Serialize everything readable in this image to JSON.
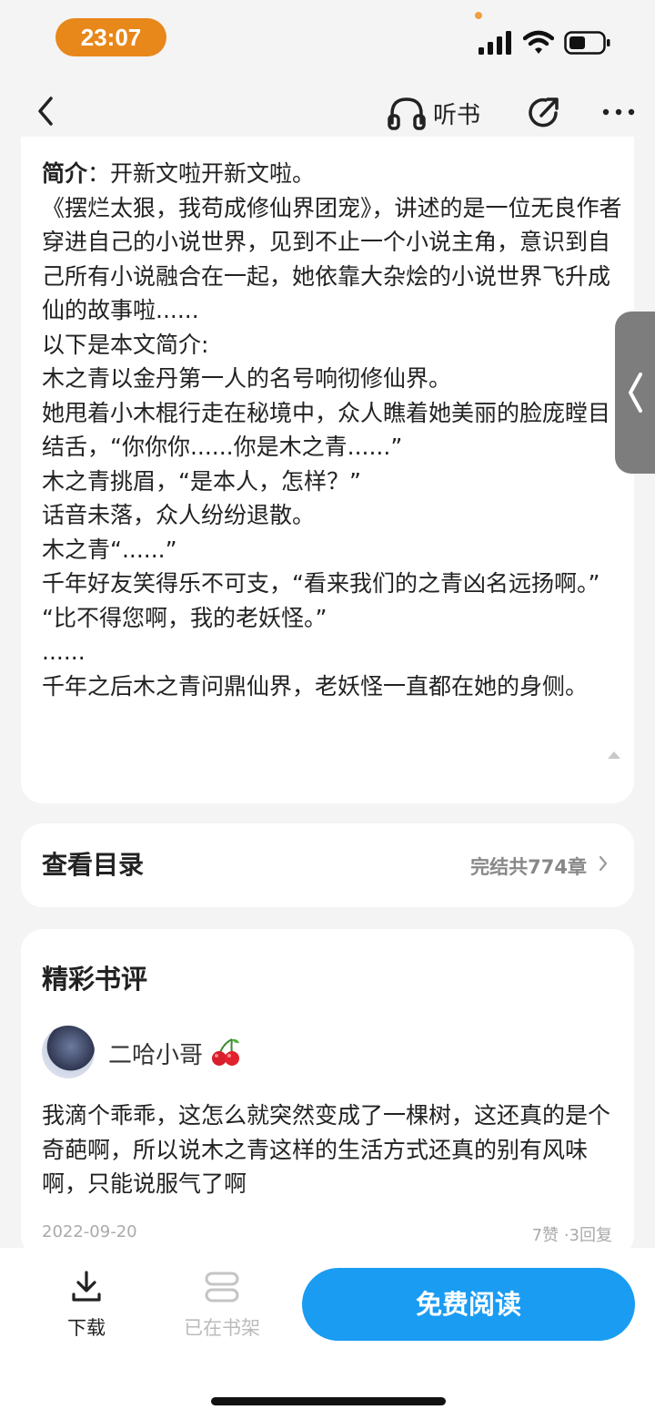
{
  "status_bar": {
    "time": "23:07"
  },
  "nav": {
    "listen_label": "听书"
  },
  "intro": {
    "label": "简介",
    "text": "：开新文啦开新文啦。\n《摆烂太狠，我苟成修仙界团宠》，讲述的是一位无良作者穿进自己的小说世界，见到不止一个小说主角，意识到自己所有小说融合在一起，她依靠大杂烩的小说世界飞升成仙的故事啦......\n以下是本文简介:\n木之青以金丹第一人的名号响彻修仙界。\n她甩着小木棍行走在秘境中，众人瞧着她美丽的脸庞瞠目结舌，“你你你......你是木之青......”\n木之青挑眉，“是本人，怎样？”\n话音未落，众人纷纷退散。\n木之青“......”\n千年好友笑得乐不可支，“看来我们的之青凶名远扬啊。”\n“比不得您啊，我的老妖怪。”\n......\n千年之后木之青问鼎仙界，老妖怪一直都在她的身侧。"
  },
  "toc": {
    "title": "查看目录",
    "status": "完结共774章"
  },
  "reviews": {
    "heading": "精彩书评",
    "items": [
      {
        "name": "二哈小哥",
        "body": "我滴个乖乖，这怎么就突然变成了一棵树，这还真的是个奇葩啊，所以说木之青这样的生活方式还真的别有风味啊，只能说服气了啊",
        "date": "2022-09-20",
        "stats": "7赞 ·3回复"
      }
    ]
  },
  "bottom": {
    "download_label": "下载",
    "shelf_label": "已在书架",
    "read_label": "免费阅读"
  },
  "colors": {
    "accent": "#1a9cf2",
    "time_pill": "#e8871a"
  }
}
